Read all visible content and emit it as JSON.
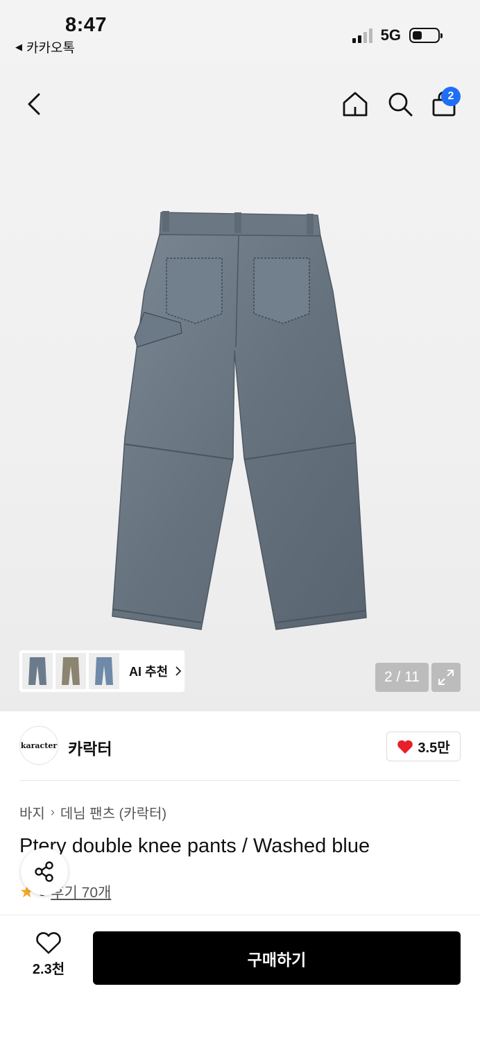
{
  "status_bar": {
    "time": "8:47",
    "back_app": "카카오톡",
    "network": "5G"
  },
  "header": {
    "cart_count": "2"
  },
  "gallery": {
    "ai_recommend_label": "AI 추천",
    "page_counter": "2 / 11"
  },
  "brand": {
    "logo_text": "karacter",
    "name": "카락터",
    "likes": "3.5만"
  },
  "product": {
    "breadcrumb": [
      "바지",
      "데님 팬츠 (카락터)"
    ],
    "title": "Ptery double knee pants / Washed blue",
    "rating_value": "5",
    "review_label": "후기 70개"
  },
  "bottom_bar": {
    "wish_count": "2.3천",
    "buy_label": "구매하기"
  },
  "colors": {
    "badge": "#1f6ef5",
    "heart": "#e8202a",
    "star": "#f5a623",
    "denim": "#6f7d8a"
  },
  "icons": [
    "back-arrow-icon",
    "home-icon",
    "search-icon",
    "shopping-bag-icon",
    "chevron-right-icon",
    "expand-icon",
    "heart-icon",
    "star-icon",
    "share-icon",
    "heart-outline-icon"
  ]
}
